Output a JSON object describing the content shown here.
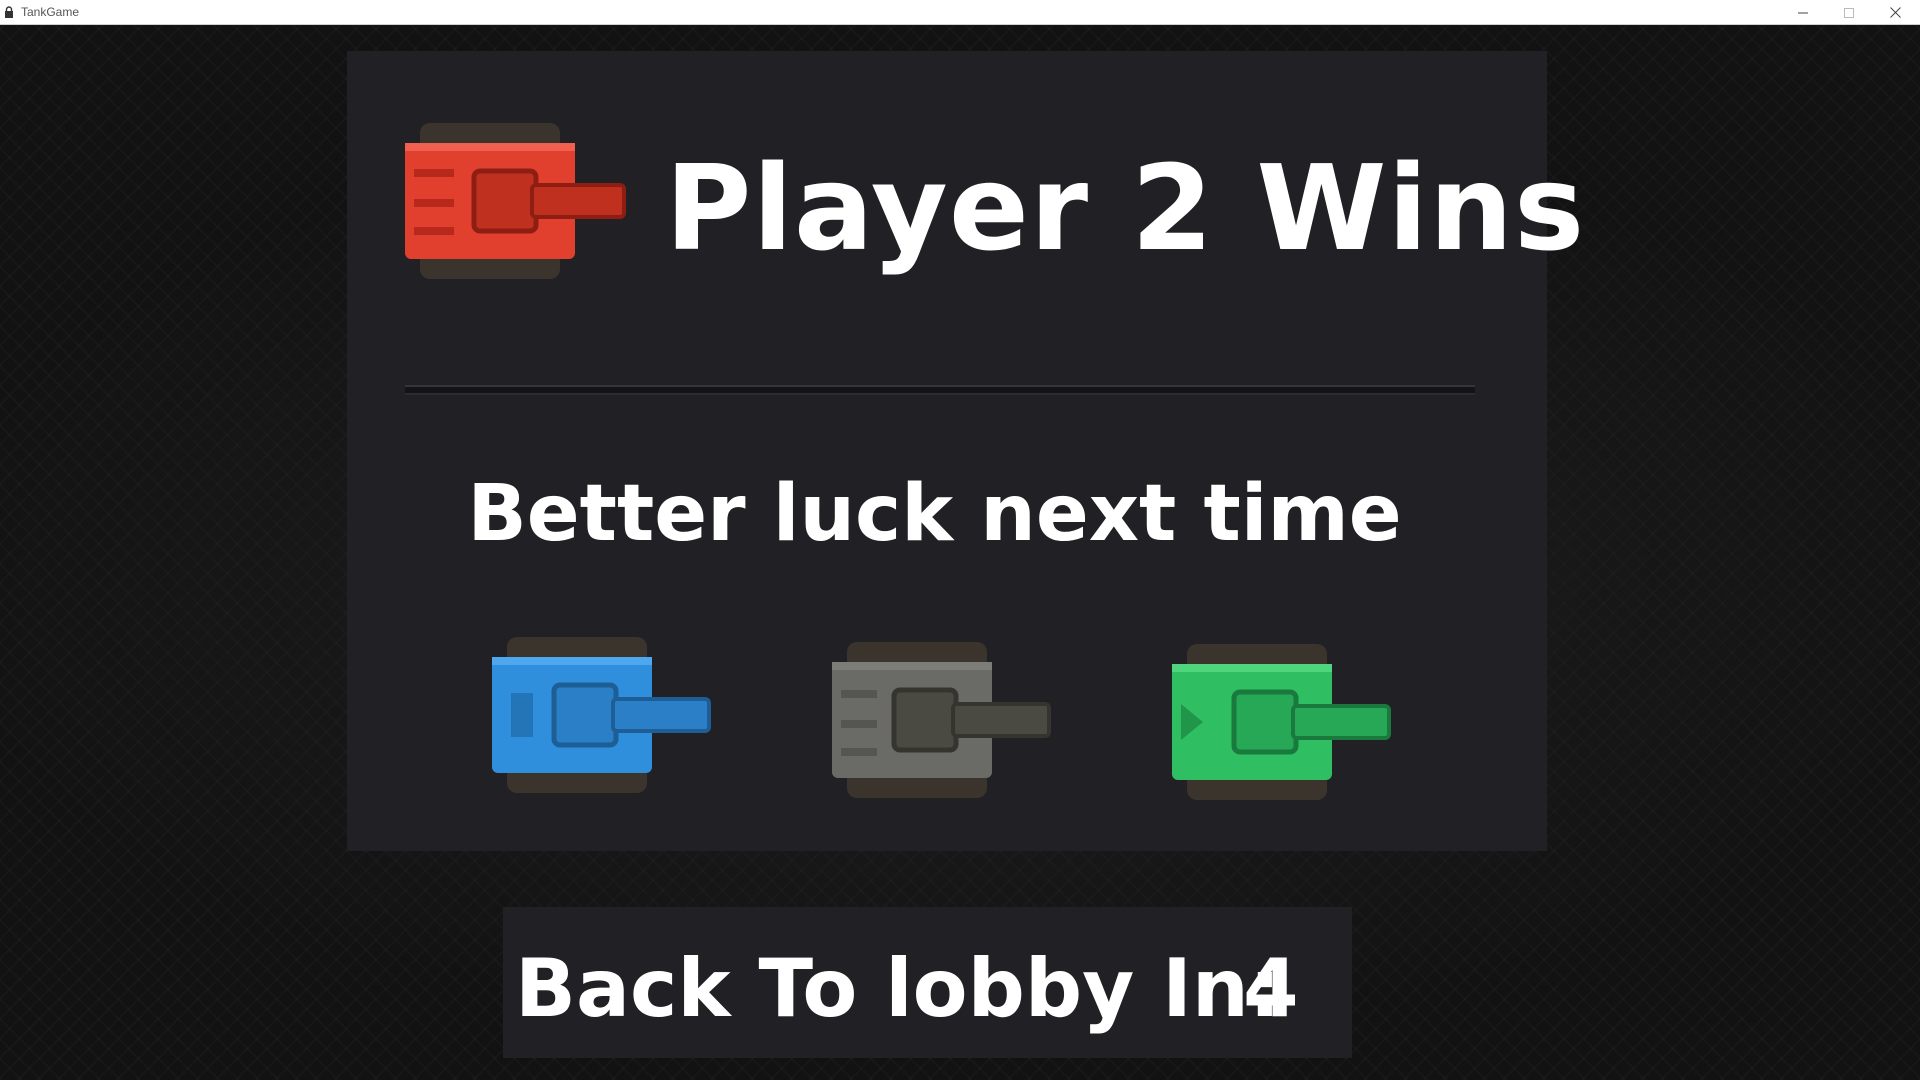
{
  "window": {
    "title": "TankGame",
    "app_icon": "lock-icon",
    "controls": [
      "minimize-icon",
      "maximize-icon",
      "close-icon"
    ]
  },
  "result": {
    "winner_title": "Player 2 Wins",
    "winner_tank": {
      "icon": "tank-icon",
      "color": "#e2402f"
    },
    "message": "Better luck next time",
    "other_tanks": [
      {
        "icon": "tank-icon",
        "color": "#2f8fdc"
      },
      {
        "icon": "tank-icon",
        "color": "#6a6a66"
      },
      {
        "icon": "tank-icon",
        "color": "#2fbf62"
      }
    ]
  },
  "countdown": {
    "label": "Back To lobby In:",
    "value": "4"
  },
  "colors": {
    "panel": "#212125",
    "text": "#ffffff"
  }
}
